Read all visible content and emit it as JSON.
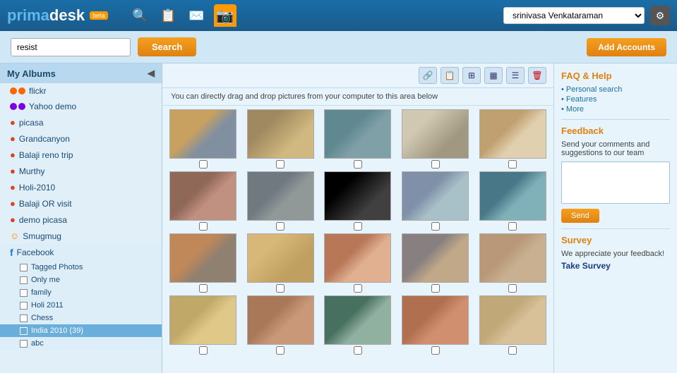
{
  "header": {
    "logo": "primadesk",
    "beta": "beta",
    "user_select_value": "srinivasa Venkataraman",
    "icons": [
      "search",
      "document",
      "mail",
      "rss"
    ]
  },
  "toolbar": {
    "search_placeholder": "resist",
    "search_value": "resist",
    "search_label": "Search",
    "add_accounts_label": "Add Accounts"
  },
  "sidebar": {
    "header": "My Albums",
    "items": [
      {
        "id": "flickr",
        "label": "flickr",
        "type": "dot",
        "dot_color": "#ff6600"
      },
      {
        "id": "yahoo-demo",
        "label": "Yahoo demo",
        "type": "dot2",
        "dot_color1": "#7a00e6",
        "dot_color2": "#7a00e6"
      },
      {
        "id": "picasa",
        "label": "picasa",
        "type": "icon-picasa"
      },
      {
        "id": "grandcanyon",
        "label": "Grandcanyon",
        "type": "icon-picasa"
      },
      {
        "id": "balaji-reno-trip",
        "label": "Balaji reno trip",
        "type": "icon-picasa"
      },
      {
        "id": "murthy",
        "label": "Murthy",
        "type": "icon-picasa"
      },
      {
        "id": "holi-2010",
        "label": "Holi-2010",
        "type": "icon-picasa"
      },
      {
        "id": "balaji-or-visit",
        "label": "Balaji OR visit",
        "type": "icon-picasa"
      },
      {
        "id": "demo-picasa",
        "label": "demo picasa",
        "type": "icon-picasa"
      },
      {
        "id": "smugmug",
        "label": "Smugmug",
        "type": "icon-smugmug"
      },
      {
        "id": "facebook",
        "label": "Facebook",
        "type": "icon-facebook"
      },
      {
        "id": "tagged-photos",
        "label": "Tagged Photos",
        "type": "sub-check",
        "indent": true
      },
      {
        "id": "only-me",
        "label": "Only me",
        "type": "sub-check",
        "indent": true
      },
      {
        "id": "family",
        "label": "family",
        "type": "sub-check",
        "indent": true
      },
      {
        "id": "holi-2011",
        "label": "Holi 2011",
        "type": "sub-check",
        "indent": true
      },
      {
        "id": "chess",
        "label": "Chess",
        "type": "sub-check",
        "indent": true
      },
      {
        "id": "india-2010",
        "label": "India 2010 (39)",
        "type": "sub-check-selected",
        "indent": true
      },
      {
        "id": "abc",
        "label": "abc",
        "type": "sub-check",
        "indent": true
      }
    ]
  },
  "content": {
    "drag_hint": "You can directly drag and drop pictures from your computer to this area below",
    "tool_icons": [
      "link",
      "copy",
      "grid",
      "grid2",
      "list",
      "trash"
    ],
    "photos": [
      {
        "id": 1,
        "cls": "p1"
      },
      {
        "id": 2,
        "cls": "p2"
      },
      {
        "id": 3,
        "cls": "p3"
      },
      {
        "id": 4,
        "cls": "p4"
      },
      {
        "id": 5,
        "cls": "p5"
      },
      {
        "id": 6,
        "cls": "p6"
      },
      {
        "id": 7,
        "cls": "p7"
      },
      {
        "id": 8,
        "cls": "p8"
      },
      {
        "id": 9,
        "cls": "p9"
      },
      {
        "id": 10,
        "cls": "p10"
      },
      {
        "id": 11,
        "cls": "p11"
      },
      {
        "id": 12,
        "cls": "p12"
      },
      {
        "id": 13,
        "cls": "p13"
      },
      {
        "id": 14,
        "cls": "p14"
      },
      {
        "id": 15,
        "cls": "p15"
      },
      {
        "id": 16,
        "cls": "p16"
      },
      {
        "id": 17,
        "cls": "p17"
      },
      {
        "id": 18,
        "cls": "p18"
      },
      {
        "id": 19,
        "cls": "p19"
      },
      {
        "id": 20,
        "cls": "p20"
      }
    ]
  },
  "right_panel": {
    "faq_title": "FAQ & Help",
    "faq_links": [
      "• Personal search",
      "• Features",
      "• More"
    ],
    "feedback_title": "Feedback",
    "feedback_text": "Send your comments and suggestions to our team",
    "feedback_placeholder": "",
    "send_label": "Send",
    "survey_title": "Survey",
    "survey_text": "We appreciate your feedback!",
    "take_survey_label": "Take Survey"
  }
}
